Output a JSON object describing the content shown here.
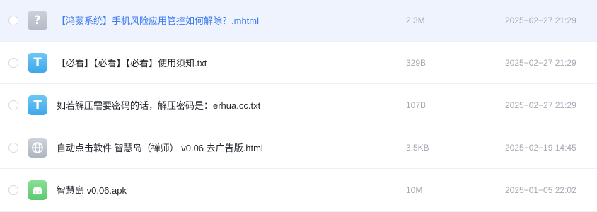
{
  "colors": {
    "selected_row_bg": "#eef3fe",
    "selected_text": "#3d7bf0",
    "primary_text": "#1f2329",
    "secondary_text": "#a4a9b2",
    "txt_icon": "#3fa7ea",
    "apk_icon": "#5dc970",
    "unknown_icon": "#b4bac5"
  },
  "files": [
    {
      "name": "【鸿蒙系统】手机风险应用管控如何解除？.mhtml",
      "size": "2.3M",
      "date": "2025−02−27 21:29",
      "icon": "unknown-file-icon",
      "selected": true
    },
    {
      "name": "【必看】【必看】【必看】使用须知.txt",
      "size": "329B",
      "date": "2025−02−27 21:29",
      "icon": "txt-file-icon",
      "selected": false
    },
    {
      "name": "如若解压需要密码的话，解压密码是：erhua.cc.txt",
      "size": "107B",
      "date": "2025−02−27 21:29",
      "icon": "txt-file-icon",
      "selected": false
    },
    {
      "name": "自动点击软件 智慧岛（禅师） v0.06 去广告版.html",
      "size": "3.5KB",
      "date": "2025−02−19 14:45",
      "icon": "web-file-icon",
      "selected": false
    },
    {
      "name": "智慧岛 v0.06.apk",
      "size": "10M",
      "date": "2025−01−05 22:02",
      "icon": "android-file-icon",
      "selected": false
    }
  ]
}
